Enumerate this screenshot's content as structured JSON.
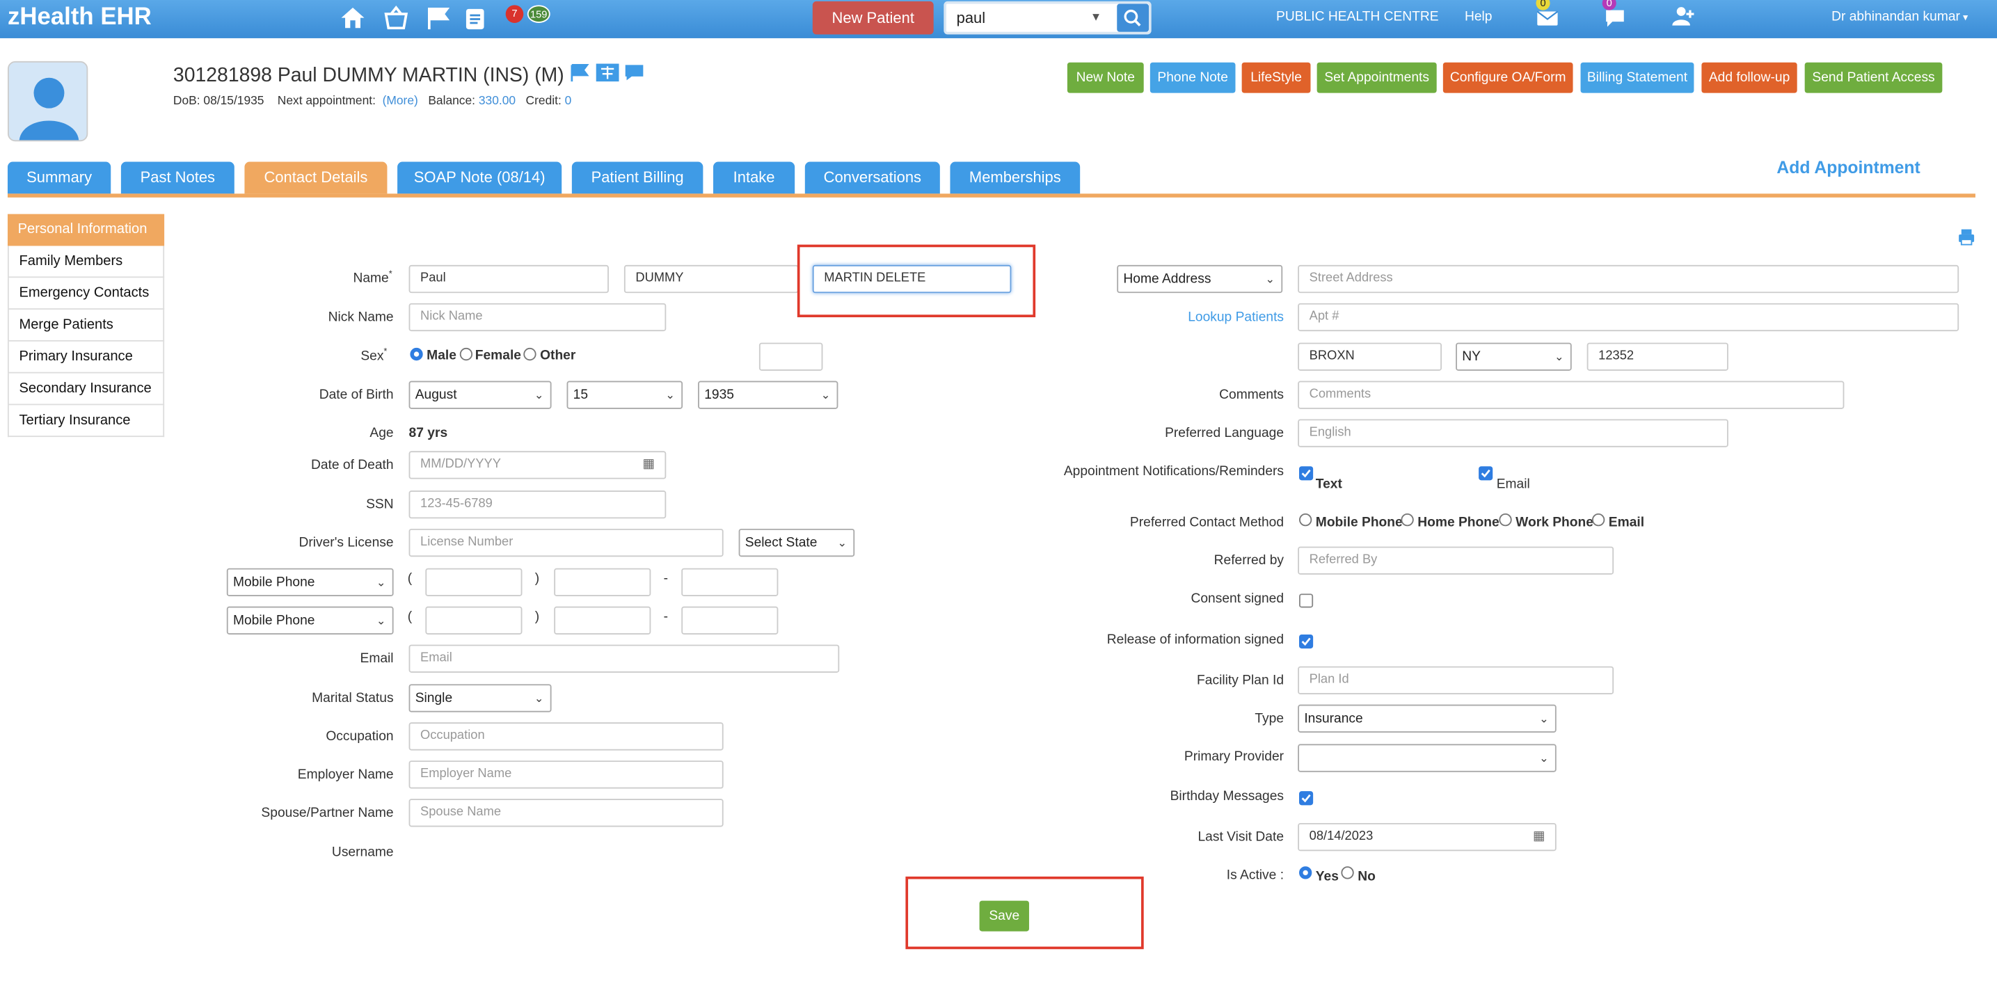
{
  "app_title": "zHealth EHR",
  "header": {
    "badge_tasks": "7",
    "badge_messages": "159",
    "new_patient_label": "New Patient",
    "search_value": "paul",
    "facility": "PUBLIC HEALTH CENTRE",
    "help": "Help",
    "mail_count": "0",
    "chat_count": "0",
    "user": "Dr abhinandan kumar"
  },
  "patient": {
    "title": "301281898 Paul DUMMY MARTIN  (INS) (M)",
    "dob_label": "DoB: 08/15/1935",
    "next_appt_label": "Next appointment:",
    "next_appt_link": "(More)",
    "balance_label": "Balance:",
    "balance_value": "330.00",
    "credit_label": "Credit:",
    "credit_value": "0"
  },
  "actions": [
    "New Note",
    "Phone Note",
    "LifeStyle",
    "Set Appointments",
    "Configure OA/Form",
    "Billing Statement",
    "Add follow-up",
    "Send Patient Access"
  ],
  "tabs": [
    "Summary",
    "Past Notes",
    "Contact Details",
    "SOAP Note (08/14)",
    "Patient Billing",
    "Intake",
    "Conversations",
    "Memberships"
  ],
  "add_appointment": "Add Appointment",
  "sidebar": [
    "Personal Information",
    "Family Members",
    "Emergency Contacts",
    "Merge Patients",
    "Primary Insurance",
    "Secondary Insurance",
    "Tertiary Insurance"
  ],
  "form_left": {
    "name_label": "Name",
    "first_name": "Paul",
    "middle_name": "DUMMY",
    "last_name": "MARTIN DELETE",
    "nickname_label": "Nick Name",
    "nickname_ph": "Nick Name",
    "sex_label": "Sex",
    "sex_male": "Male",
    "sex_female": "Female",
    "sex_other": "Other",
    "dob_label": "Date of Birth",
    "dob_month": "August",
    "dob_day": "15",
    "dob_year": "1935",
    "age_label": "Age",
    "age_value": "87 yrs",
    "dod_label": "Date of Death",
    "dod_ph": "MM/DD/YYYY",
    "ssn_label": "SSN",
    "ssn_ph": "123-45-6789",
    "license_label": "Driver's License",
    "license_ph": "License Number",
    "license_state": "Select State",
    "phone1_type": "Mobile Phone",
    "phone2_type": "Mobile Phone",
    "email_label": "Email",
    "email_ph": "Email",
    "marital_label": "Marital Status",
    "marital_value": "Single",
    "occupation_label": "Occupation",
    "occupation_ph": "Occupation",
    "employer_label": "Employer Name",
    "employer_ph": "Employer Name",
    "spouse_label": "Spouse/Partner Name",
    "spouse_ph": "Spouse Name",
    "username_label": "Username"
  },
  "form_right": {
    "address_type": "Home Address",
    "street_ph": "Street Address",
    "lookup": "Lookup Patients",
    "apt_ph": "Apt #",
    "city": "BROXN",
    "state": "NY",
    "zip": "12352",
    "comments_label": "Comments",
    "comments_ph": "Comments",
    "language_label": "Preferred Language",
    "language_ph": "English",
    "notif_label": "Appointment Notifications/Reminders",
    "notif_text": "Text",
    "notif_email": "Email",
    "contact_label": "Preferred Contact Method",
    "contact_mobile": "Mobile Phone",
    "contact_home": "Home Phone",
    "contact_work": "Work Phone",
    "contact_email": "Email",
    "referred_label": "Referred by",
    "referred_ph": "Referred By",
    "consent_label": "Consent signed",
    "release_label": "Release of information signed",
    "plan_label": "Facility Plan Id",
    "plan_ph": "Plan Id",
    "type_label": "Type",
    "type_value": "Insurance",
    "provider_label": "Primary Provider",
    "birthday_label": "Birthday Messages",
    "lastvisit_label": "Last Visit Date",
    "lastvisit_value": "08/14/2023",
    "active_label": "Is Active :",
    "active_yes": "Yes",
    "active_no": "No"
  },
  "save_label": "Save"
}
